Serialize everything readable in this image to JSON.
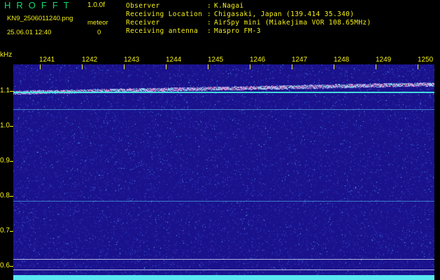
{
  "header": {
    "app_title": "HROFFT",
    "app_version": "1.0.0f",
    "filename": "KN9_2506011240.png",
    "meteor_label": "meteor",
    "datetime": "25.06.01 12:40",
    "meteor_count": "0"
  },
  "info": {
    "observer_key": "Observer",
    "observer_value": "K.Nagai",
    "location_key": "Receiving Location",
    "location_value": "Chigasaki, Japan (139.414 35.340)",
    "receiver_key": "Receiver",
    "receiver_value": "AirSpy mini (Miakejima VOR 108.65MHz)",
    "antenna_key": "Receiving antenna",
    "antenna_value": "Maspro FM-3",
    "separator": ":"
  },
  "axes": {
    "y_unit": "kHz",
    "y_ticks": [
      "1.1",
      "1.0",
      "0.9",
      "0.8",
      "0.7",
      "0.6"
    ],
    "x_ticks": [
      "1241",
      "1242",
      "1243",
      "1244",
      "1245",
      "1246",
      "1247",
      "1248",
      "1249",
      "1250"
    ]
  },
  "colors": {
    "background": "#000000",
    "text": "#f4ef18",
    "title": "#16d96a",
    "spectrogram_base": "#1a128c",
    "signal_line": "#48f0e6",
    "reference_line": "#c8d0e8",
    "noise_floor": "#58e6f0"
  }
}
